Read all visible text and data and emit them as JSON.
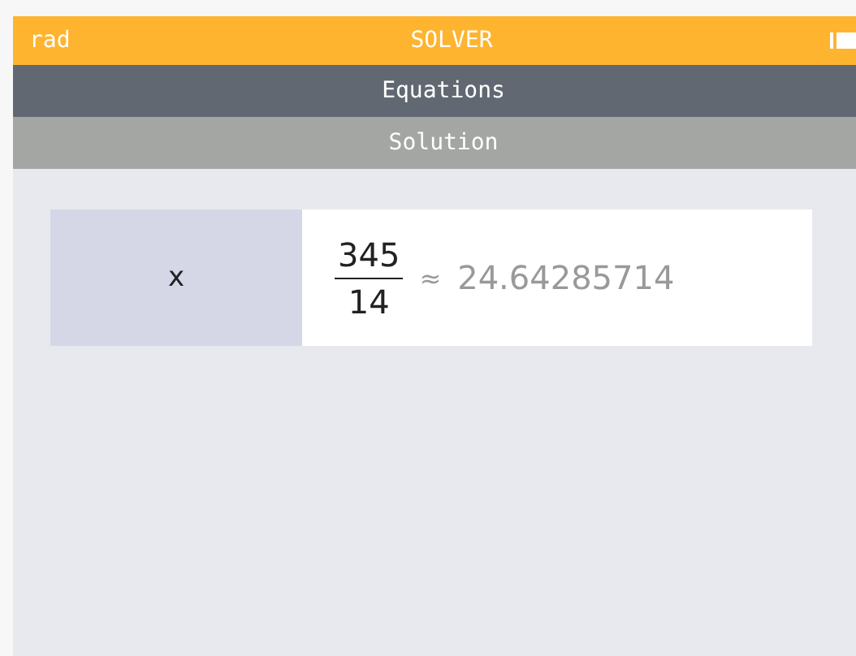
{
  "status_bar": {
    "angle_unit": "rad",
    "title": "SOLVER"
  },
  "title_bar": "Equations",
  "subtitle_bar": "Solution",
  "solutions": [
    {
      "variable": "x",
      "numerator": "345",
      "denominator": "14",
      "approx_sign": "≈",
      "approx_value": "24.64285714"
    }
  ]
}
